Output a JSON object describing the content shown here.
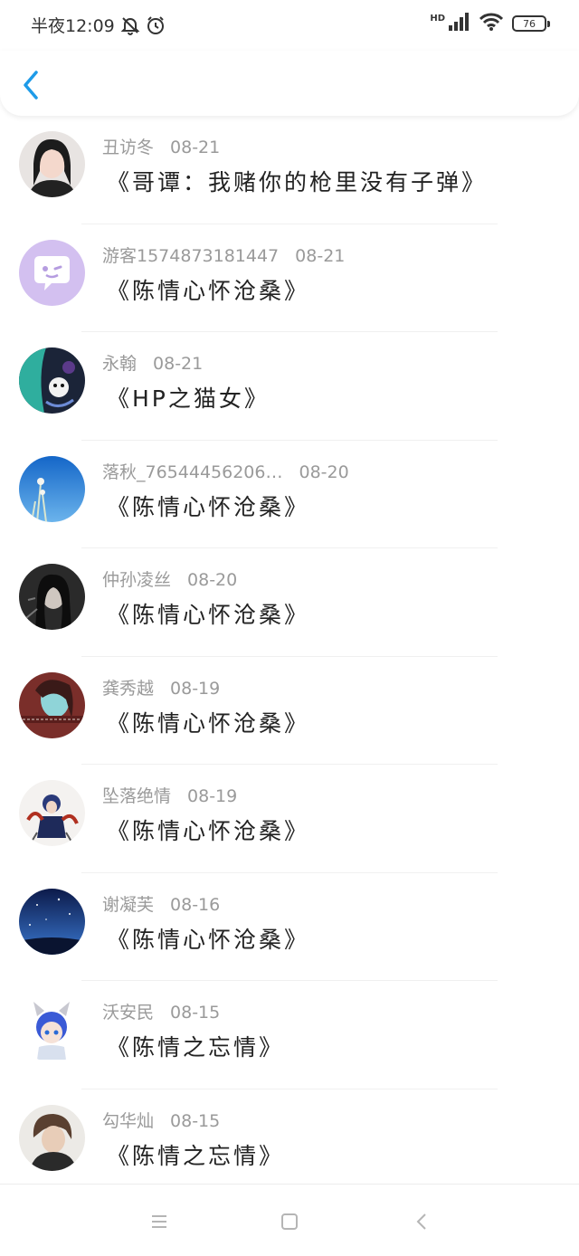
{
  "status_bar": {
    "time": "半夜12:09",
    "network": "HD",
    "battery": "76"
  },
  "header": {
    "back_icon": "chevron-left-icon",
    "accent": "#1e9be8"
  },
  "items": [
    {
      "name": "丑访冬",
      "date": "08-21",
      "title": "《哥谭：我赌你的枪里没有子弹》"
    },
    {
      "name": "游客1574873181447",
      "date": "08-21",
      "title": "《陈情心怀沧桑》"
    },
    {
      "name": "永翰",
      "date": "08-21",
      "title": "《HP之猫女》"
    },
    {
      "name": "落秋_76544456206…",
      "date": "08-20",
      "title": "《陈情心怀沧桑》"
    },
    {
      "name": "仲孙凌丝",
      "date": "08-20",
      "title": "《陈情心怀沧桑》"
    },
    {
      "name": "龚秀越",
      "date": "08-19",
      "title": "《陈情心怀沧桑》"
    },
    {
      "name": "坠落绝情",
      "date": "08-19",
      "title": "《陈情心怀沧桑》"
    },
    {
      "name": "谢凝芙",
      "date": "08-16",
      "title": "《陈情心怀沧桑》"
    },
    {
      "name": "沃安民",
      "date": "08-15",
      "title": "《陈情之忘情》"
    },
    {
      "name": "勾华灿",
      "date": "08-15",
      "title": "《陈情之忘情》"
    }
  ],
  "nav": {
    "menu_icon": "menu-icon",
    "home_icon": "home-square-icon",
    "back_icon": "back-triangle-icon"
  }
}
